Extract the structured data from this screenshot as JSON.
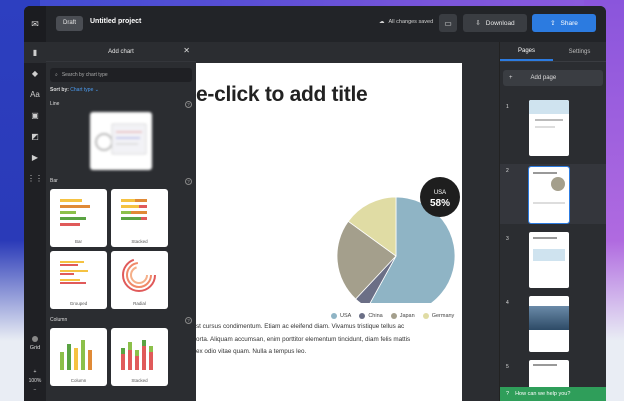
{
  "topbar": {
    "draft_label": "Draft",
    "project_title": "Untitled project",
    "saved_status": "All changes saved",
    "download_label": "Download",
    "share_label": "Share"
  },
  "rail": {
    "grid_label": "Grid",
    "zoom_level": "100%",
    "zoom_in": "+",
    "zoom_out": "−",
    "icons": [
      "chart-icon",
      "infographic-icon",
      "text-icon",
      "image-icon",
      "shapes-icon",
      "video-icon",
      "apps-icon"
    ]
  },
  "panel": {
    "title": "Add chart",
    "search_placeholder": "Search by chart type",
    "sort_label": "Sort by:",
    "sort_value": "Chart type",
    "sections": {
      "line": "Line",
      "bar": "Bar",
      "column": "Column"
    },
    "bar_thumbs": [
      "Bar",
      "Stacked",
      "Grouped",
      "Radial"
    ],
    "column_thumbs": [
      "Column",
      "Stacked"
    ]
  },
  "canvas": {
    "title_placeholder": "e-click to add title",
    "badge_label": "USA",
    "badge_value": "58%",
    "body_lines": [
      "st cursus condimentum. Etiam ac eleifend diam. Vivamus tristique tellus ac",
      "orta. Aliquam accumsan, enim porttitor elementum tincidunt, diam felis mattis",
      "ex odio vitae quam. Nulla a tempus leo."
    ],
    "legend": [
      {
        "label": "USA",
        "color": "#8fb4c5"
      },
      {
        "label": "China",
        "color": "#6b6f86"
      },
      {
        "label": "Japan",
        "color": "#a49f8c"
      },
      {
        "label": "Germany",
        "color": "#e0dca4"
      }
    ]
  },
  "chart_data": {
    "type": "pie",
    "categories": [
      "USA",
      "China",
      "Japan",
      "Germany"
    ],
    "values": [
      58,
      4,
      23,
      15
    ],
    "colors": [
      "#8fb4c5",
      "#6b6f86",
      "#a49f8c",
      "#e0dca4"
    ],
    "annotation": "USA 58%"
  },
  "pages_panel": {
    "tab_pages": "Pages",
    "tab_settings": "Settings",
    "add_page_label": "Add page",
    "page_numbers": [
      "1",
      "2",
      "3",
      "4",
      "5"
    ],
    "help_label": "How can we help you?"
  },
  "colors": {
    "accent": "#2c7be0",
    "help": "#2f9e5a"
  }
}
